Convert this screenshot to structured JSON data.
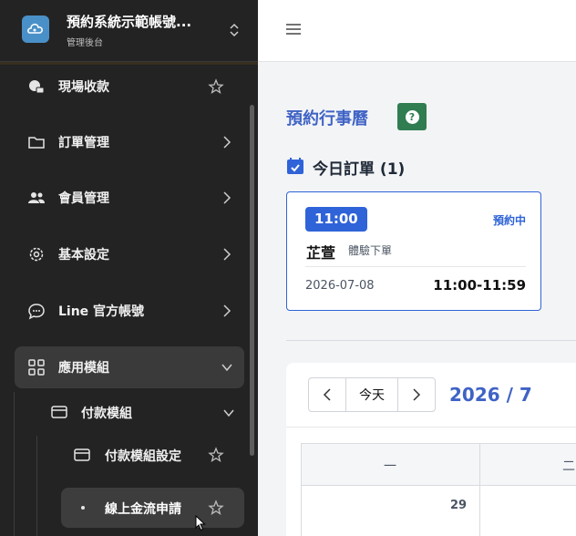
{
  "app": {
    "title": "預約系統示範帳號...",
    "subtitle": "管理後台"
  },
  "sidebar": {
    "items": [
      {
        "label": "現場收款",
        "icon": "pay-icon"
      },
      {
        "label": "訂單管理",
        "icon": "folder-icon"
      },
      {
        "label": "會員管理",
        "icon": "users-icon"
      },
      {
        "label": "基本設定",
        "icon": "gear-icon"
      },
      {
        "label": "Line 官方帳號",
        "icon": "chat-icon"
      },
      {
        "label": "應用模組",
        "icon": "grid-icon"
      }
    ],
    "submenu": {
      "label": "付款模組",
      "items": [
        {
          "label": "付款模組設定"
        },
        {
          "label": "線上金流申請"
        }
      ]
    }
  },
  "main": {
    "calendar_title": "預約行事曆",
    "help_label": "?",
    "today_heading": "今日訂單 (1)",
    "order": {
      "time": "11:00",
      "status": "預約中",
      "name": "芷萱",
      "type": "體驗下單",
      "date": "2026-07-08",
      "range": "11:00-11:59"
    },
    "calendar": {
      "today_btn": "今天",
      "month": "2026 / 7",
      "day_headers": [
        "一",
        "二"
      ],
      "first_day": "29"
    }
  },
  "colors": {
    "accent": "#2f63d8",
    "title": "#3f63c5",
    "help_green": "#2f7d51",
    "sidebar_bg": "#232323"
  }
}
